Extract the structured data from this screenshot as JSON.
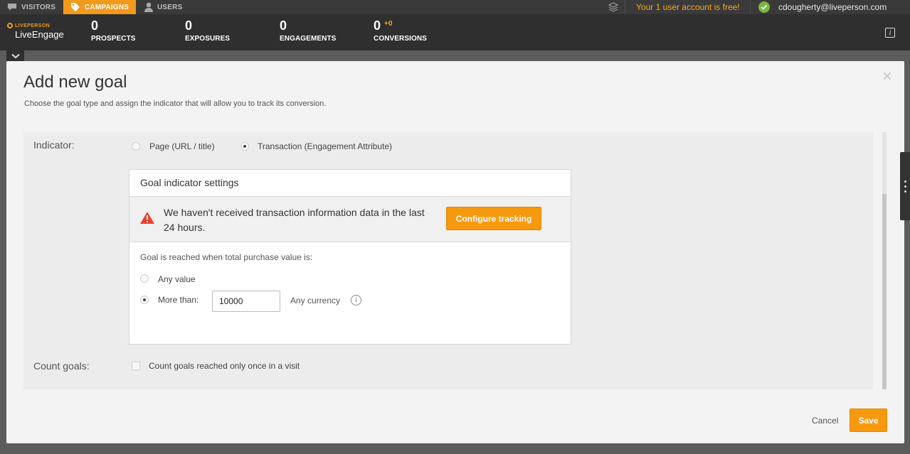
{
  "topbar": {
    "tabs": [
      {
        "label": "VISITORS",
        "icon": "chat-bubble-icon"
      },
      {
        "label": "CAMPAIGNS",
        "icon": "tag-icon"
      },
      {
        "label": "USERS",
        "icon": "user-icon"
      }
    ],
    "free_note": "Your 1 user account is free!",
    "user_email": "cdougherty@liveperson.com"
  },
  "brand": {
    "small": "LIVEPERSON",
    "big": "LiveEngage"
  },
  "stats": [
    {
      "value": "0",
      "label": "PROSPECTS"
    },
    {
      "value": "0",
      "label": "EXPOSURES"
    },
    {
      "value": "0",
      "label": "ENGAGEMENTS"
    },
    {
      "value": "0",
      "label": "CONVERSIONS",
      "delta": "+0"
    }
  ],
  "modal": {
    "title": "Add new goal",
    "subtitle": "Choose the goal type and assign the indicator that will allow you to track its conversion.",
    "close": "×",
    "indicator": {
      "label": "Indicator:",
      "options": [
        "Page (URL / title)",
        "Transaction (Engagement Attribute)"
      ],
      "selected": "Transaction (Engagement Attribute)"
    },
    "panel": {
      "title": "Goal indicator settings",
      "warning": "We haven't received transaction information data in the last 24 hours.",
      "configure_button": "Configure tracking",
      "condition_label": "Goal is reached when total purchase value is:",
      "options": [
        "Any value",
        "More than:"
      ],
      "selected": "More than:",
      "amount": "10000",
      "currency_label": "Any currency"
    },
    "count_goals": {
      "label": "Count goals:",
      "checkbox_label": "Count goals reached only once in a visit",
      "checked": false
    },
    "footer": {
      "cancel": "Cancel",
      "save": "Save"
    }
  },
  "colors": {
    "accent": "#f7990f",
    "topbar": "#3a3a3a",
    "statsbar": "#2f2f2f",
    "warning": "#e8402f",
    "online": "#7ab740"
  }
}
